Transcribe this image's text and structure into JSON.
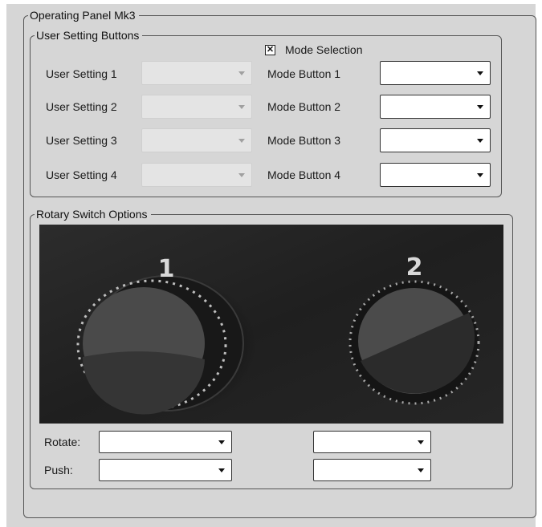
{
  "panel": {
    "title": "Operating Panel Mk3"
  },
  "user_settings": {
    "title": "User Setting Buttons",
    "mode_selection_label": "Mode Selection",
    "mode_selection_checked_glyph": "✕",
    "rows": [
      {
        "setting_label": "User Setting 1",
        "setting_value": "",
        "mode_label": "Mode Button 1",
        "mode_value": ""
      },
      {
        "setting_label": "User Setting 2",
        "setting_value": "",
        "mode_label": "Mode Button 2",
        "mode_value": ""
      },
      {
        "setting_label": "User Setting 3",
        "setting_value": "",
        "mode_label": "Mode Button 3",
        "mode_value": ""
      },
      {
        "setting_label": "User Setting 4",
        "setting_value": "",
        "mode_label": "Mode Button 4",
        "mode_value": ""
      }
    ]
  },
  "rotary": {
    "title": "Rotary Switch Options",
    "knob_1_label": "1",
    "knob_2_label": "2",
    "rotate_label": "Rotate:",
    "push_label": "Push:",
    "rotate_1_value": "",
    "rotate_2_value": "",
    "push_1_value": "",
    "push_2_value": ""
  }
}
